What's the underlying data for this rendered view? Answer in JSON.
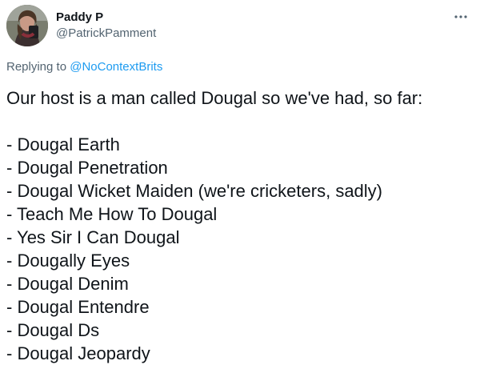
{
  "tweet": {
    "author": {
      "display_name": "Paddy P",
      "handle": "@PatrickPamment"
    },
    "reply": {
      "prefix": "Replying to",
      "mention": "@NoContextBrits"
    },
    "intro": "Our host is a man called Dougal so we've had, so far:",
    "items": [
      "- Dougal Earth",
      "- Dougal Penetration",
      "- Dougal Wicket Maiden (we're cricketers, sadly)",
      "- Teach Me How To Dougal",
      "- Yes Sir I Can Dougal",
      "- Dougally Eyes",
      "- Dougal Denim",
      "- Dougal Entendre",
      "- Dougal Ds",
      "- Dougal Jeopardy"
    ]
  },
  "icons": {
    "more": "more-dots-icon",
    "avatar": "avatar-photo"
  },
  "colors": {
    "text": "#0f1419",
    "secondary": "#536471",
    "accent": "#1d9bf0",
    "background": "#ffffff"
  }
}
